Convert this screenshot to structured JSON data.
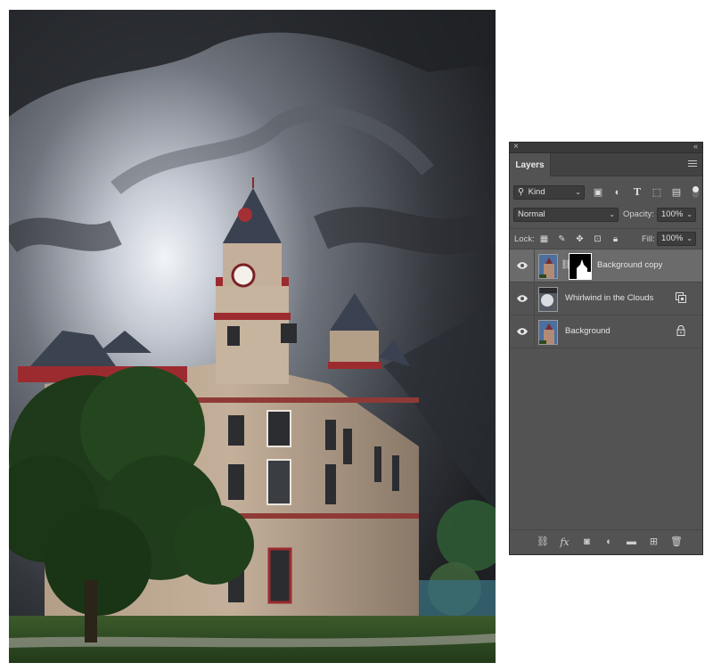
{
  "photo": {
    "description_icon": "courthouse-photo"
  },
  "panel": {
    "close_glyph": "×",
    "collapse_glyph": "‹‹",
    "tab_label": "Layers",
    "filter": {
      "kind_label": "Kind",
      "icons": [
        "image-filter-icon",
        "adjustment-filter-icon",
        "type-filter-icon",
        "shape-filter-icon",
        "smart-object-filter-icon"
      ]
    },
    "blend_mode": "Normal",
    "opacity_label": "Opacity:",
    "opacity_value": "100%",
    "lock_label": "Lock:",
    "fill_label": "Fill:",
    "fill_value": "100%",
    "layers": [
      {
        "name": "Background copy",
        "selected": true,
        "has_mask": true
      },
      {
        "name": "Whirlwind in the Clouds",
        "selected": false,
        "smart_object": true
      },
      {
        "name": "Background",
        "selected": false,
        "locked": true
      }
    ],
    "colors": {
      "panel_bg": "#535353",
      "selected_bg": "#6b6b6b",
      "text": "#e4e4e4"
    }
  }
}
